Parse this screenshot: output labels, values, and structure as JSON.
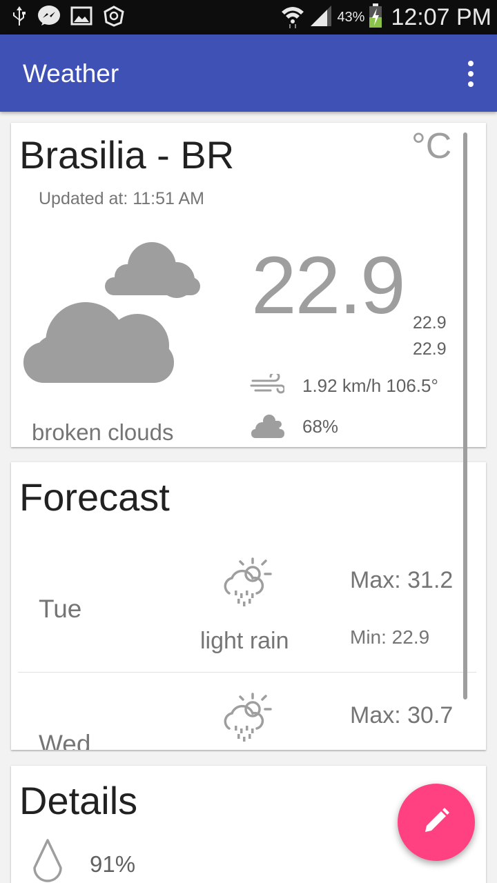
{
  "status_bar": {
    "battery_percent": "43%",
    "time": "12:07 PM",
    "icons": [
      "usb-icon",
      "messenger-icon",
      "gallery-icon",
      "app-icon",
      "wifi-icon",
      "signal-icon",
      "battery-charging-icon"
    ]
  },
  "app_bar": {
    "title": "Weather",
    "menu_icon": "more-vert-icon"
  },
  "current": {
    "city": "Brasilia - BR",
    "unit": "°C",
    "updated": "Updated at: 11:51 AM",
    "icon": "broken-clouds-icon",
    "description": "broken clouds",
    "temperature": "22.9",
    "temp_max": "22.9",
    "temp_min": "22.9",
    "wind": "1.92 km/h 106.5°",
    "cloudiness": "68%"
  },
  "forecast": {
    "title": "Forecast",
    "days": [
      {
        "day": "Tue",
        "icon": "light-rain-icon",
        "description": "light rain",
        "max": "Max: 31.2",
        "min": "Min: 22.9"
      },
      {
        "day": "Wed",
        "icon": "light-rain-icon",
        "max": "Max: 30.7"
      }
    ]
  },
  "details": {
    "title": "Details",
    "humidity": "91%"
  },
  "fab": {
    "icon": "edit-pencil-icon"
  },
  "colors": {
    "primary": "#3f51b5",
    "accent": "#ff4081",
    "icon_gray": "#9e9e9e"
  }
}
